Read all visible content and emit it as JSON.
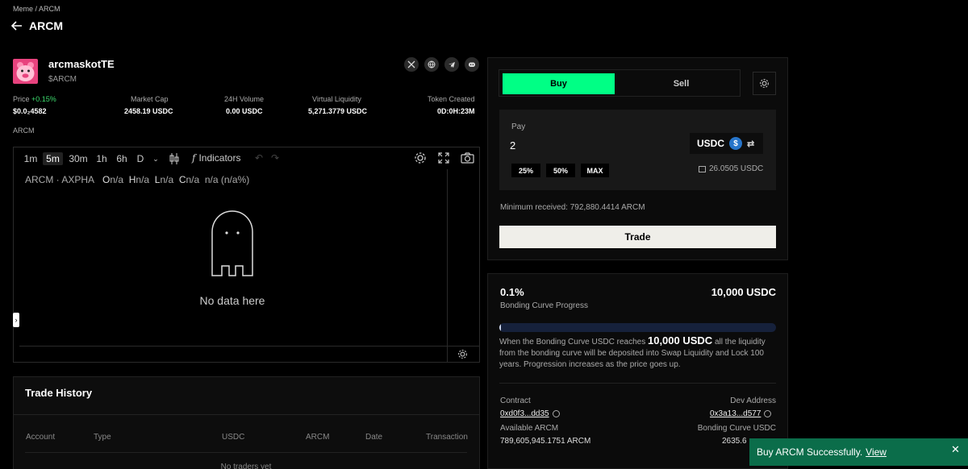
{
  "breadcrumb": "Meme / ARCM",
  "header": {
    "title": "ARCM"
  },
  "token": {
    "name": "arcmaskotTE",
    "symbol": "$ARCM"
  },
  "socials": [
    "x-icon",
    "globe-icon",
    "telegram-icon",
    "discord-icon"
  ],
  "stats": {
    "price_label": "Price",
    "price_change": "+0.15%",
    "price_value": "$0.0₂4582",
    "mcap_label": "Market Cap",
    "mcap_value": "2458.19 USDC",
    "vol_label": "24H Volume",
    "vol_value": "0.00 USDC",
    "liq_label": "Virtual Liquidity",
    "liq_value": "5,271.3779 USDC",
    "created_label": "Token Created",
    "created_value": "0D:0H:23M"
  },
  "chart_section_label": "ARCM",
  "chart": {
    "timeframes": [
      "1m",
      "5m",
      "30m",
      "1h",
      "6h",
      "D"
    ],
    "active_timeframe": "5m",
    "indicators_label": "Indicators",
    "legend": {
      "symbol": "ARCM · AXPHA",
      "o_label": "O",
      "o": "n/a",
      "h_label": "H",
      "h": "n/a",
      "l_label": "L",
      "l": "n/a",
      "c_label": "C",
      "c": "n/a",
      "chg": "n/a (n/a%)"
    },
    "empty_text": "No data here"
  },
  "trade_history": {
    "title": "Trade History",
    "columns": [
      "Account",
      "Type",
      "USDC",
      "ARCM",
      "Date",
      "Transaction"
    ],
    "empty_text": "No traders yet"
  },
  "trade": {
    "buy_label": "Buy",
    "sell_label": "Sell",
    "pay_label": "Pay",
    "pay_value": "2",
    "currency": "USDC",
    "pct_buttons": [
      "25%",
      "50%",
      "MAX"
    ],
    "balance": "26.0505 USDC",
    "min_received": "Minimum received: 792,880.4414 ARCM",
    "trade_button": "Trade"
  },
  "bonding": {
    "progress_text": "0.1%",
    "progress_fraction": 0.006,
    "target": "10,000 USDC",
    "label": "Bonding Curve Progress",
    "desc_pre": "When the Bonding Curve USDC reaches",
    "desc_big": "10,000 USDC",
    "desc_post": "all the liquidity from the bonding curve will be deposited into Swap Liquidity and Lock 100 years. Progression increases as the price goes up.",
    "contract_label": "Contract",
    "contract_value": "0xd0f3...dd35",
    "dev_label": "Dev Address",
    "dev_value": "0x3a13...d577",
    "available_label": "Available ARCM",
    "available_value": "789,605,945.1751 ARCM",
    "curve_usdc_label": "Bonding Curve USDC",
    "curve_usdc_value": "2635.6"
  },
  "toast": {
    "message": "Buy ARCM Successfully.",
    "link": "View"
  },
  "colors": {
    "accent": "#00ff85",
    "toast": "#0b6d4a",
    "price_up": "#3ddc6e"
  }
}
